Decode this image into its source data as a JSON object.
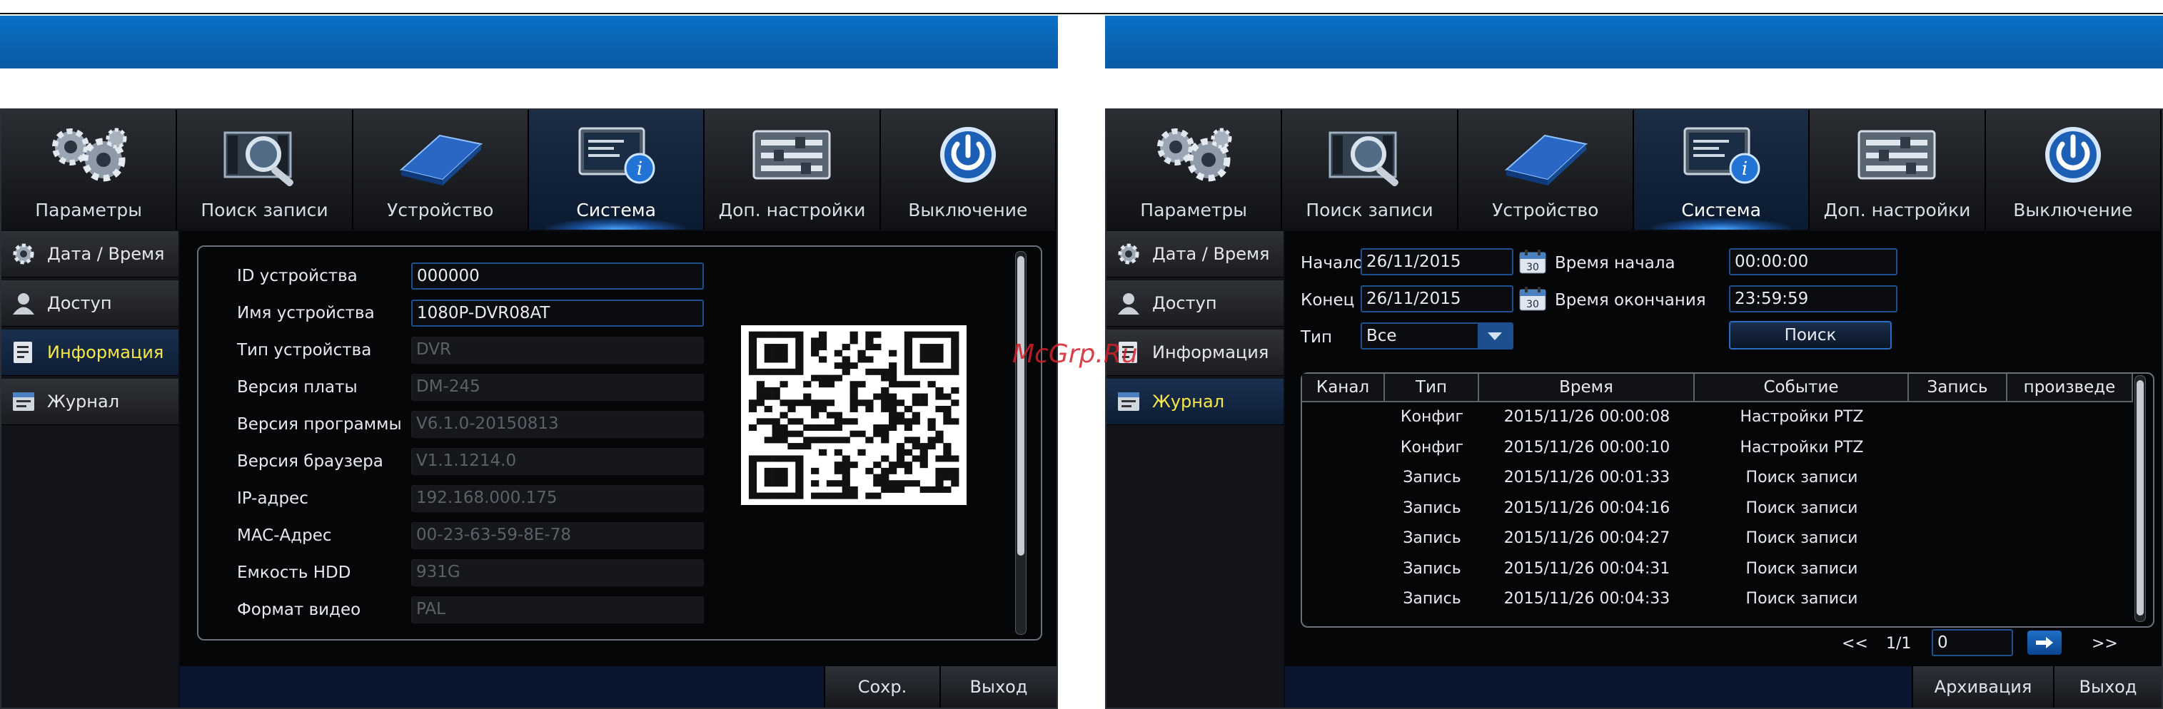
{
  "tabs": [
    "Параметры",
    "Поиск записи",
    "Устройство",
    "Система",
    "Доп. настройки",
    "Выключение"
  ],
  "active_tab": "Система",
  "sidebar": [
    "Дата / Время",
    "Доступ",
    "Информация",
    "Журнал"
  ],
  "left": {
    "active_side": "Информация",
    "fields": [
      {
        "label": "ID устройства",
        "value": "000000",
        "editable": true
      },
      {
        "label": "Имя устройства",
        "value": "1080P-DVR08AT",
        "editable": true
      },
      {
        "label": "Тип устройства",
        "value": "DVR",
        "editable": false
      },
      {
        "label": "Версия платы",
        "value": "DM-245",
        "editable": false
      },
      {
        "label": "Версия программы",
        "value": "V6.1.0-20150813",
        "editable": false
      },
      {
        "label": "Версия браузера",
        "value": "V1.1.1214.0",
        "editable": false
      },
      {
        "label": "IP-адрес",
        "value": "192.168.000.175",
        "editable": false
      },
      {
        "label": "MAC-Адрес",
        "value": "00-23-63-59-8E-78",
        "editable": false
      },
      {
        "label": "Емкость HDD",
        "value": "931G",
        "editable": false
      },
      {
        "label": "Формат видео",
        "value": "PAL",
        "editable": false
      }
    ],
    "buttons": {
      "save": "Сохр.",
      "exit": "Выход"
    }
  },
  "right": {
    "active_side": "Журнал",
    "start_label": "Начало",
    "start_date": "26/11/2015",
    "start_time_label": "Время начала",
    "start_time": "00:00:00",
    "end_label": "Конец",
    "end_date": "26/11/2015",
    "end_time_label": "Время окончания",
    "end_time": "23:59:59",
    "type_label": "Тип",
    "type_value": "Все",
    "search_button": "Поиск",
    "calendar_day": "30",
    "columns": [
      "Канал",
      "Тип",
      "Время",
      "Событие",
      "Запись",
      "произведе"
    ],
    "rows": [
      {
        "type": "Конфиг",
        "time": "2015/11/26 00:00:08",
        "event": "Настройки PTZ"
      },
      {
        "type": "Конфиг",
        "time": "2015/11/26 00:00:10",
        "event": "Настройки PTZ"
      },
      {
        "type": "Запись",
        "time": "2015/11/26 00:01:33",
        "event": "Поиск записи"
      },
      {
        "type": "Запись",
        "time": "2015/11/26 00:04:16",
        "event": "Поиск записи"
      },
      {
        "type": "Запись",
        "time": "2015/11/26 00:04:27",
        "event": "Поиск записи"
      },
      {
        "type": "Запись",
        "time": "2015/11/26 00:04:31",
        "event": "Поиск записи"
      },
      {
        "type": "Запись",
        "time": "2015/11/26 00:04:33",
        "event": "Поиск записи"
      }
    ],
    "pager": {
      "prev": "<<",
      "page": "1/1",
      "input": "0",
      "next": ">>"
    },
    "buttons": {
      "archive": "Архивация",
      "exit": "Выход"
    }
  },
  "watermark": "McGrp.Ru"
}
